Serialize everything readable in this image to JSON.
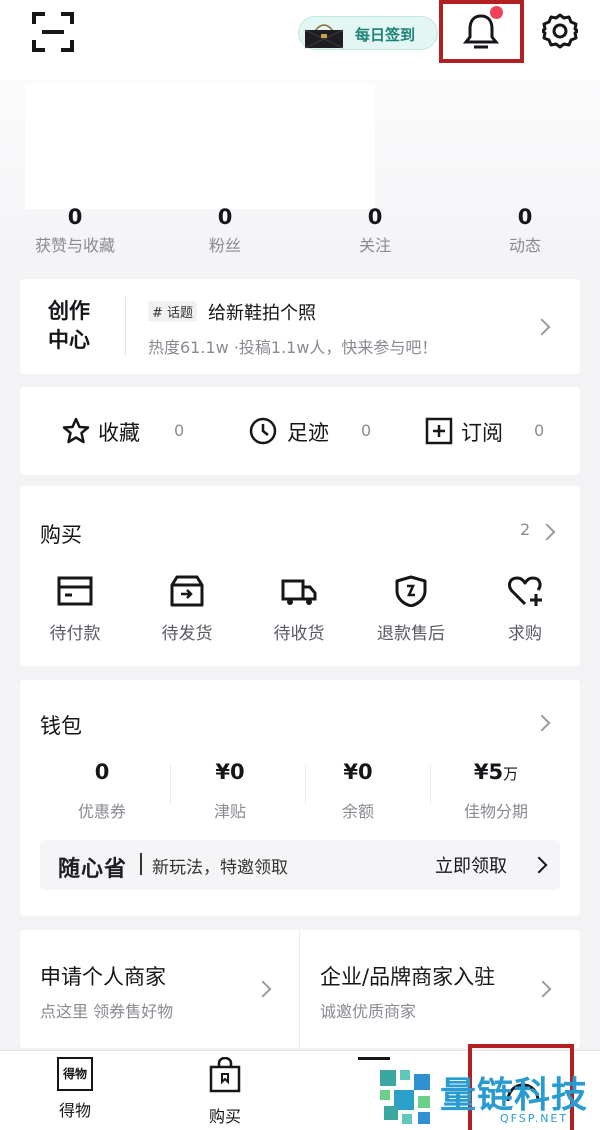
{
  "header": {
    "signin_label": "每日签到"
  },
  "stats": [
    {
      "value": "0",
      "label": "获赞与收藏"
    },
    {
      "value": "0",
      "label": "粉丝"
    },
    {
      "value": "0",
      "label": "关注"
    },
    {
      "value": "0",
      "label": "动态"
    }
  ],
  "creation": {
    "title_line1": "创作",
    "title_line2": "中心",
    "tag": "# 话题",
    "topic": "给新鞋拍个照",
    "subtitle": "热度61.1w ·投稿1.1w人，快来参与吧！"
  },
  "quick_links": [
    {
      "label": "收藏",
      "count": "0",
      "icon": "star-icon"
    },
    {
      "label": "足迹",
      "count": "0",
      "icon": "clock-icon"
    },
    {
      "label": "订阅",
      "count": "0",
      "icon": "plus-square-icon"
    }
  ],
  "purchase": {
    "title": "购买",
    "count": "2",
    "orders": [
      {
        "label": "待付款",
        "icon": "card-icon"
      },
      {
        "label": "待发货",
        "icon": "box-icon"
      },
      {
        "label": "待收货",
        "icon": "truck-icon"
      },
      {
        "label": "退款售后",
        "icon": "shield-icon"
      },
      {
        "label": "求购",
        "icon": "heart-plus-icon"
      }
    ]
  },
  "wallet": {
    "title": "钱包",
    "items": [
      {
        "value": "0",
        "label": "优惠券"
      },
      {
        "value": "¥0",
        "label": "津贴"
      },
      {
        "value": "¥0",
        "label": "余额"
      },
      {
        "value": "¥5",
        "unit": "万",
        "label": "佳物分期"
      }
    ],
    "banner_logo": "随心省",
    "banner_text": "新玩法，特邀领取",
    "banner_action": "立即领取"
  },
  "merchant": {
    "personal_title": "申请个人商家",
    "personal_sub": "点这里 领券售好物",
    "brand_title": "企业/品牌商家入驻",
    "brand_sub": "诚邀优质商家"
  },
  "tabbar": [
    {
      "label": "得物",
      "icon_text": "得物"
    },
    {
      "label": "购买",
      "icon_text": ""
    }
  ],
  "watermark": {
    "title": "量链科技",
    "domain": "QFSP.NET"
  },
  "colors": {
    "accent": "#1e8276",
    "badge": "#f04256",
    "highlight": "#b22121"
  }
}
